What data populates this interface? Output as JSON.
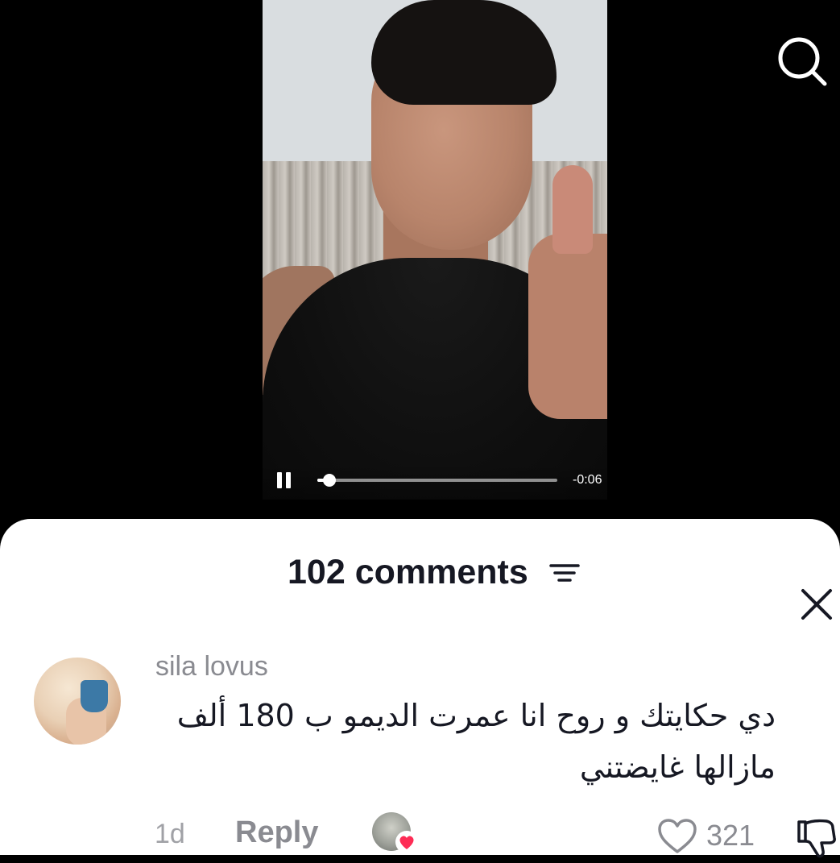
{
  "video": {
    "time_remaining": "-0:06",
    "progress": 0.05,
    "playing": true
  },
  "top_bar": {
    "search_icon": "search-icon"
  },
  "comments": {
    "title": "102 comments",
    "sort_icon": "sort-icon",
    "close_icon": "close-icon",
    "items": [
      {
        "username": "sila lovus",
        "text_line1": "دي حكايتك و روح انا عمرت الديمو ب 180 ألف",
        "text_line2": "مازالها غايضتني",
        "timestamp": "1d",
        "reply_label": "Reply",
        "liked_by_creator": true,
        "like_count": "321"
      }
    ]
  },
  "colors": {
    "accent_heart": "#fe2c55",
    "text_primary": "#161823",
    "text_secondary": "#8a8b91"
  }
}
